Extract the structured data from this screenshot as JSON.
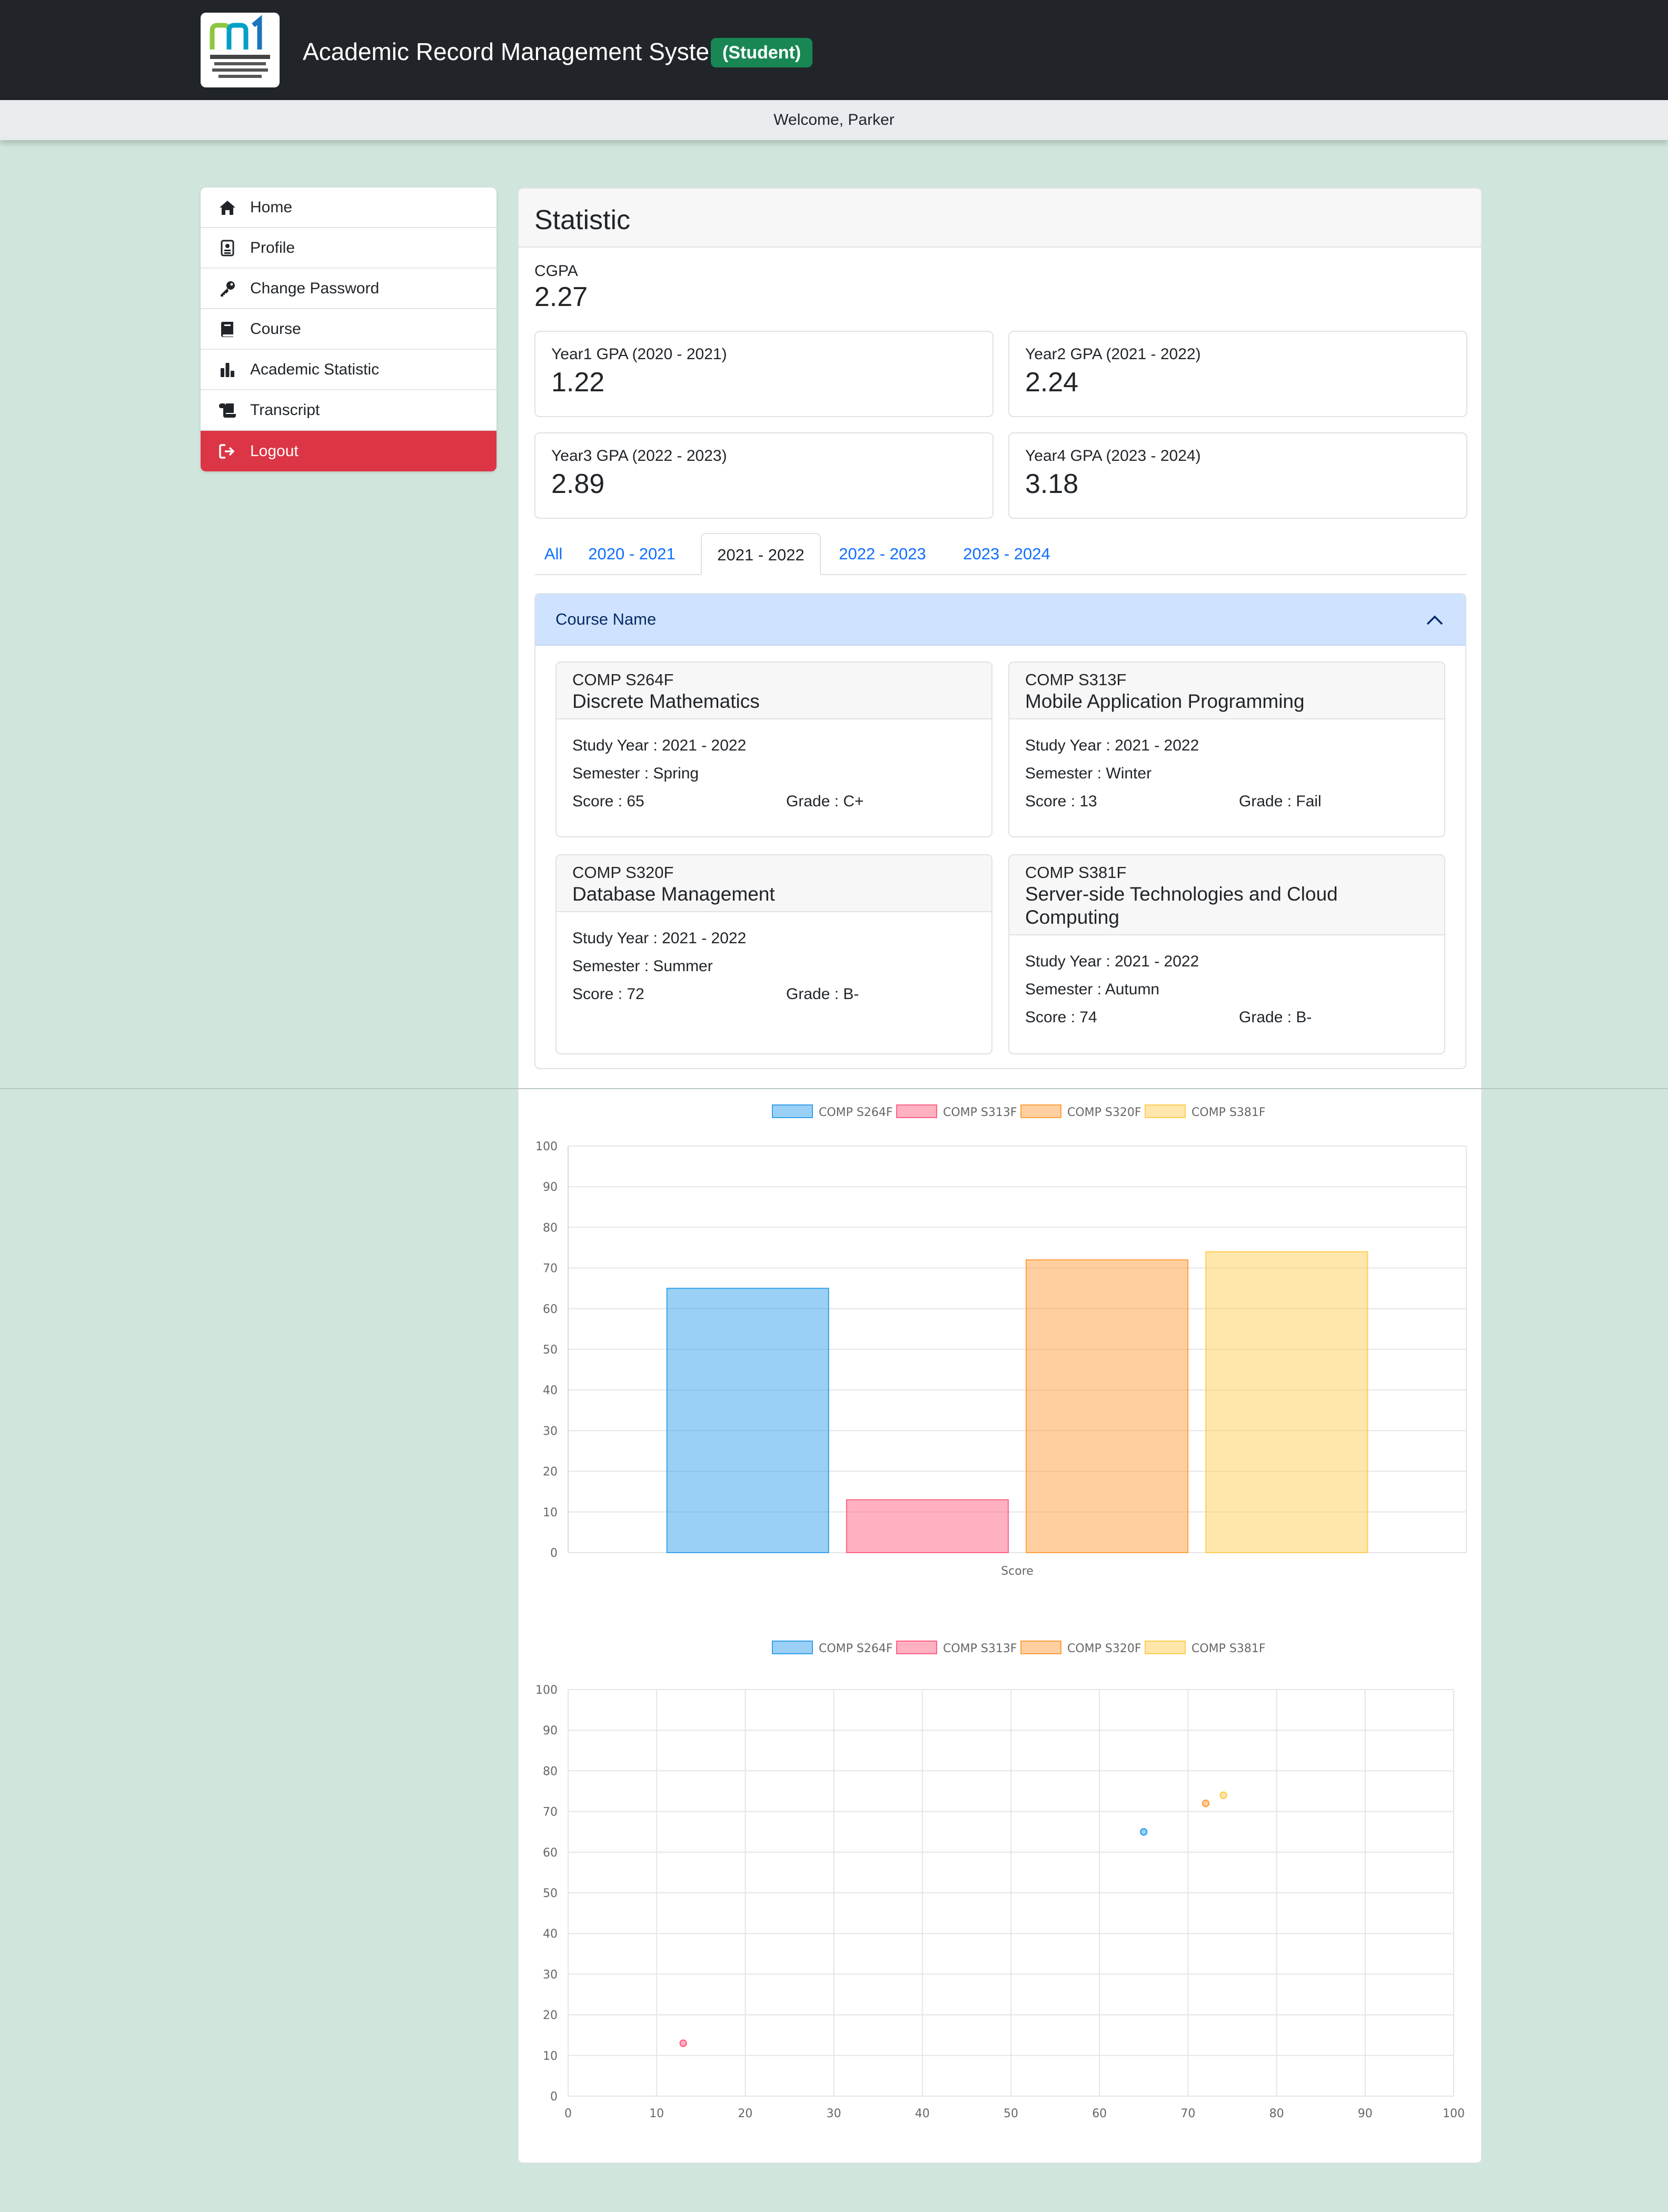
{
  "header": {
    "app_title": "Academic Record Management System",
    "role_badge": "(Student)",
    "logo_name": "HKMU logo"
  },
  "welcome": "Welcome, Parker",
  "sidebar": {
    "items": [
      {
        "label": "Home",
        "icon": "home-icon"
      },
      {
        "label": "Profile",
        "icon": "id-card-icon"
      },
      {
        "label": "Change Password",
        "icon": "key-icon"
      },
      {
        "label": "Course",
        "icon": "book-icon"
      },
      {
        "label": "Academic Statistic",
        "icon": "bar-chart-icon"
      },
      {
        "label": "Transcript",
        "icon": "scroll-icon"
      },
      {
        "label": "Logout",
        "icon": "logout-icon"
      }
    ]
  },
  "main": {
    "title": "Statistic",
    "cgpa_label": "CGPA",
    "cgpa_value": "2.27",
    "gpa_cards": [
      {
        "label": "Year1 GPA (2020 - 2021)",
        "value": "1.22"
      },
      {
        "label": "Year2 GPA (2021 - 2022)",
        "value": "2.24"
      },
      {
        "label": "Year3 GPA (2022 - 2023)",
        "value": "2.89"
      },
      {
        "label": "Year4 GPA (2023 - 2024)",
        "value": "3.18"
      }
    ],
    "tabs": [
      "All",
      "2020 - 2021",
      "2021 - 2022",
      "2022 - 2023",
      "2023 - 2024"
    ],
    "active_tab": "2021 - 2022",
    "accordion_title": "Course Name",
    "courses": [
      {
        "code": "COMP S264F",
        "name": "Discrete Mathematics",
        "study_year": "Study Year : 2021 - 2022",
        "semester": "Semester : Spring",
        "score": "Score : 65",
        "grade": "Grade : C+"
      },
      {
        "code": "COMP S313F",
        "name": "Mobile Application Programming",
        "study_year": "Study Year : 2021 - 2022",
        "semester": "Semester : Winter",
        "score": "Score : 13",
        "grade": "Grade : Fail"
      },
      {
        "code": "COMP S320F",
        "name": "Database Management",
        "study_year": "Study Year : 2021 - 2022",
        "semester": "Semester : Summer",
        "score": "Score : 72",
        "grade": "Grade : B-"
      },
      {
        "code": "COMP S381F",
        "name": "Server-side Technologies and Cloud Computing",
        "study_year": "Study Year : 2021 - 2022",
        "semester": "Semester : Autumn",
        "score": "Score : 74",
        "grade": "Grade : B-"
      }
    ]
  },
  "colors": {
    "nav_dark": "#212529",
    "badge_green": "#198754",
    "logout_red": "#dc3545",
    "link_blue": "#0d6efd",
    "page_bg": "#d0e5dc"
  },
  "chart_data": [
    {
      "type": "bar",
      "categories": [
        "Score"
      ],
      "series": [
        {
          "name": "COMP S264F",
          "values": [
            65
          ],
          "color": "#36a2eb"
        },
        {
          "name": "COMP S313F",
          "values": [
            13
          ],
          "color": "#ff6384"
        },
        {
          "name": "COMP S320F",
          "values": [
            72
          ],
          "color": "#ff9f40"
        },
        {
          "name": "COMP S381F",
          "values": [
            74
          ],
          "color": "#ffcd56"
        }
      ],
      "xlabel": "Score",
      "ylim": [
        0,
        100
      ],
      "yticks": [
        0,
        10,
        20,
        30,
        40,
        50,
        60,
        70,
        80,
        90,
        100
      ],
      "legend": "top",
      "grid": true
    },
    {
      "type": "scatter",
      "series": [
        {
          "name": "COMP S264F",
          "points": [
            [
              65,
              65
            ]
          ],
          "color": "#36a2eb"
        },
        {
          "name": "COMP S313F",
          "points": [
            [
              13,
              13
            ]
          ],
          "color": "#ff6384"
        },
        {
          "name": "COMP S320F",
          "points": [
            [
              72,
              72
            ]
          ],
          "color": "#ff9f40"
        },
        {
          "name": "COMP S381F",
          "points": [
            [
              74,
              74
            ]
          ],
          "color": "#ffcd56"
        }
      ],
      "xlim": [
        0,
        100
      ],
      "ylim": [
        0,
        100
      ],
      "xticks": [
        0,
        10,
        20,
        30,
        40,
        50,
        60,
        70,
        80,
        90,
        100
      ],
      "yticks": [
        0,
        10,
        20,
        30,
        40,
        50,
        60,
        70,
        80,
        90,
        100
      ],
      "legend": "top",
      "grid": true
    }
  ]
}
